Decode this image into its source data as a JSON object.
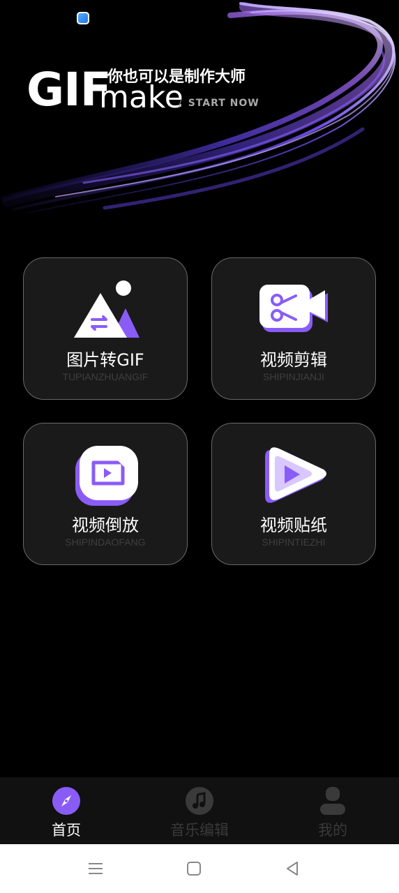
{
  "hero": {
    "brand_gif": "GIF",
    "brand_make": "make",
    "slogan": "你也可以是制作大师",
    "separator": "/",
    "start_now": "START NOW"
  },
  "features": [
    {
      "title": "图片转GIF",
      "subtitle": "TUPIANZHUANGIF",
      "icon": "image-convert-icon"
    },
    {
      "title": "视频剪辑",
      "subtitle": "SHIPINJIANJI",
      "icon": "video-cut-icon"
    },
    {
      "title": "视频倒放",
      "subtitle": "SHIPINDAOFANG",
      "icon": "video-reverse-icon"
    },
    {
      "title": "视频贴纸",
      "subtitle": "SHIPINTIEZHI",
      "icon": "video-sticker-icon"
    }
  ],
  "tabbar": {
    "items": [
      {
        "label": "首页",
        "icon": "compass-icon",
        "active": true
      },
      {
        "label": "音乐编辑",
        "icon": "music-icon",
        "active": false
      },
      {
        "label": "我的",
        "icon": "profile-icon",
        "active": false
      }
    ]
  },
  "colors": {
    "accent": "#8a5cf6",
    "card_bg": "#1a1a1a",
    "card_border": "#6a6a6a",
    "tab_inactive": "#3a3a3a"
  }
}
